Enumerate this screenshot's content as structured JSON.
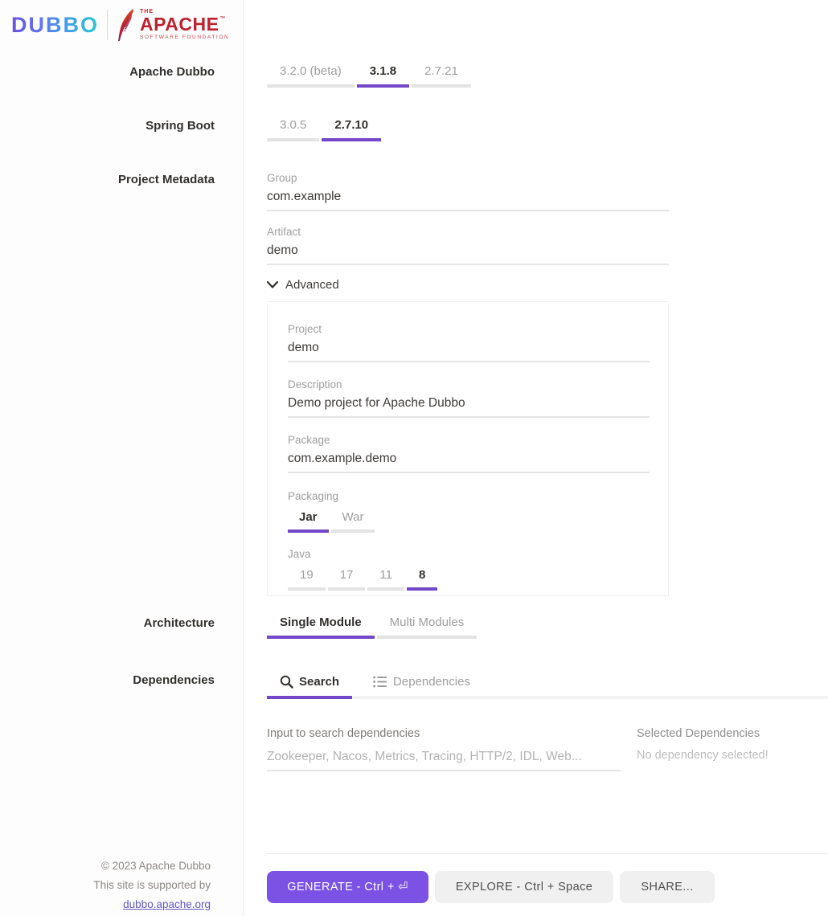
{
  "brand": {
    "dubbo_logo_text": "DUBBO",
    "apache": {
      "the": "THE",
      "name": "APACHE",
      "tm": "™",
      "subtitle": "SOFTWARE FOUNDATION"
    }
  },
  "sidebar": {
    "sections": [
      {
        "label": "Apache Dubbo"
      },
      {
        "label": "Spring Boot"
      },
      {
        "label": "Project Metadata"
      },
      {
        "label": "Architecture"
      },
      {
        "label": "Dependencies"
      }
    ],
    "footer": {
      "copyright": "© 2023 Apache Dubbo",
      "support": "This site is supported by",
      "link": "dubbo.apache.org"
    }
  },
  "dubbo_versions": {
    "options": [
      {
        "label": "3.2.0 (beta)",
        "active": false
      },
      {
        "label": "3.1.8",
        "active": true
      },
      {
        "label": "2.7.21",
        "active": false
      }
    ]
  },
  "spring_boot_versions": {
    "options": [
      {
        "label": "3.0.5",
        "active": false
      },
      {
        "label": "2.7.10",
        "active": true
      }
    ]
  },
  "metadata": {
    "group": {
      "label": "Group",
      "value": "com.example"
    },
    "artifact": {
      "label": "Artifact",
      "value": "demo"
    },
    "advanced_label": "Advanced",
    "project": {
      "label": "Project",
      "value": "demo"
    },
    "description": {
      "label": "Description",
      "value": "Demo project for Apache Dubbo"
    },
    "package": {
      "label": "Package",
      "value": "com.example.demo"
    },
    "packaging": {
      "label": "Packaging",
      "options": [
        {
          "label": "Jar",
          "active": true
        },
        {
          "label": "War",
          "active": false
        }
      ]
    },
    "java": {
      "label": "Java",
      "options": [
        {
          "label": "19",
          "active": false
        },
        {
          "label": "17",
          "active": false
        },
        {
          "label": "11",
          "active": false
        },
        {
          "label": "8",
          "active": true
        }
      ]
    }
  },
  "architecture": {
    "options": [
      {
        "label": "Single Module",
        "active": true
      },
      {
        "label": "Multi Modules",
        "active": false
      }
    ]
  },
  "dependencies": {
    "tabs": [
      {
        "label": "Search",
        "icon": "search-icon",
        "active": true
      },
      {
        "label": "Dependencies",
        "icon": "list-icon",
        "active": false
      }
    ],
    "search_label": "Input to search dependencies",
    "search_placeholder": "Zookeeper, Nacos, Metrics, Tracing, HTTP/2, IDL, Web...",
    "selected_title": "Selected Dependencies",
    "selected_empty": "No dependency selected!"
  },
  "actions": {
    "generate": "GENERATE - Ctrl + ⏎",
    "explore": "EXPLORE - Ctrl + Space",
    "share": "SHARE..."
  },
  "colors": {
    "accent_indicator": "#7446C8",
    "accent_button": "#7B52E3",
    "inactive_underline": "#E3E3E3",
    "apache_red": "#BE202E",
    "link_purple": "#6457C5"
  }
}
